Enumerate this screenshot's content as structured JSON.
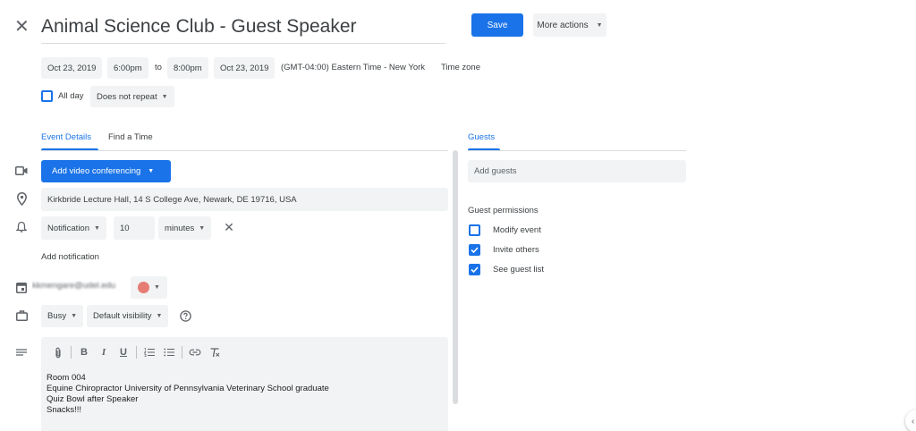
{
  "header": {
    "close_icon": "close-icon",
    "title": "Animal Science Club - Guest Speaker",
    "save_label": "Save",
    "more_actions_label": "More actions"
  },
  "datetime": {
    "start_date": "Oct 23, 2019",
    "start_time": "6:00pm",
    "to_label": "to",
    "end_time": "8:00pm",
    "end_date": "Oct 23, 2019",
    "timezone_value": "(GMT-04:00) Eastern Time - New York",
    "timezone_label": "Time zone",
    "all_day_label": "All day",
    "all_day_checked": false,
    "repeat_value": "Does not repeat"
  },
  "tabs": {
    "event_details": "Event Details",
    "find_a_time": "Find a Time",
    "guests": "Guests"
  },
  "details": {
    "video_button_label": "Add video conferencing",
    "location": "Kirkbride Lecture Hall, 14 S College Ave, Newark, DE 19716, USA",
    "notification_type": "Notification",
    "notification_amount": "10",
    "notification_unit": "minutes",
    "add_notification_label": "Add notification",
    "calendar_owner": "kkmengare@udel.edu",
    "event_color": "#e67c73",
    "availability": "Busy",
    "visibility": "Default visibility",
    "description": "Room 004\nEquine Chiropractor University of Pennsylvania Veterinary School graduate\nQuiz Bowl after Speaker\nSnacks!!!"
  },
  "guests": {
    "add_guests_placeholder": "Add guests",
    "permissions_title": "Guest permissions",
    "permissions": [
      {
        "label": "Modify event",
        "checked": false
      },
      {
        "label": "Invite others",
        "checked": true
      },
      {
        "label": "See guest list",
        "checked": true
      }
    ]
  },
  "colors": {
    "accent": "#1a73e8",
    "chip_bg": "#f1f3f4",
    "text": "#3c4043"
  }
}
